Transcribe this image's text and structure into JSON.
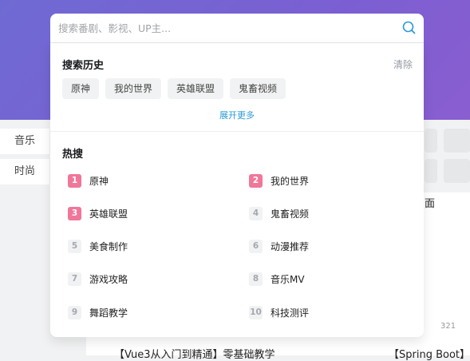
{
  "search": {
    "placeholder": "搜索番剧、影视、UP主..."
  },
  "history": {
    "title": "搜索历史",
    "clear_label": "清除",
    "items": [
      "原神",
      "我的世界",
      "英雄联盟",
      "鬼畜视频"
    ],
    "expand_label": "展开更多"
  },
  "hot": {
    "title": "热搜",
    "items": [
      {
        "rank": "1",
        "label": "原神"
      },
      {
        "rank": "2",
        "label": "我的世界"
      },
      {
        "rank": "3",
        "label": "英雄联盟"
      },
      {
        "rank": "4",
        "label": "鬼畜视频"
      },
      {
        "rank": "5",
        "label": "美食制作"
      },
      {
        "rank": "6",
        "label": "动漫推荐"
      },
      {
        "rank": "7",
        "label": "游戏攻略"
      },
      {
        "rank": "8",
        "label": "音乐MV"
      },
      {
        "rank": "9",
        "label": "舞蹈教学"
      },
      {
        "rank": "10",
        "label": "科技测评"
      }
    ]
  },
  "background": {
    "categories": [
      "音乐",
      "时尚"
    ],
    "right_title": "面",
    "view_count": "321",
    "video_titles": [
      "【Vue3从入门到精通】零基础教学",
      "【Spring Boot】微"
    ]
  },
  "colors": {
    "accent": "#2a9bd6",
    "hot_top": "#f0779a",
    "hero": "#6f6ad3"
  }
}
